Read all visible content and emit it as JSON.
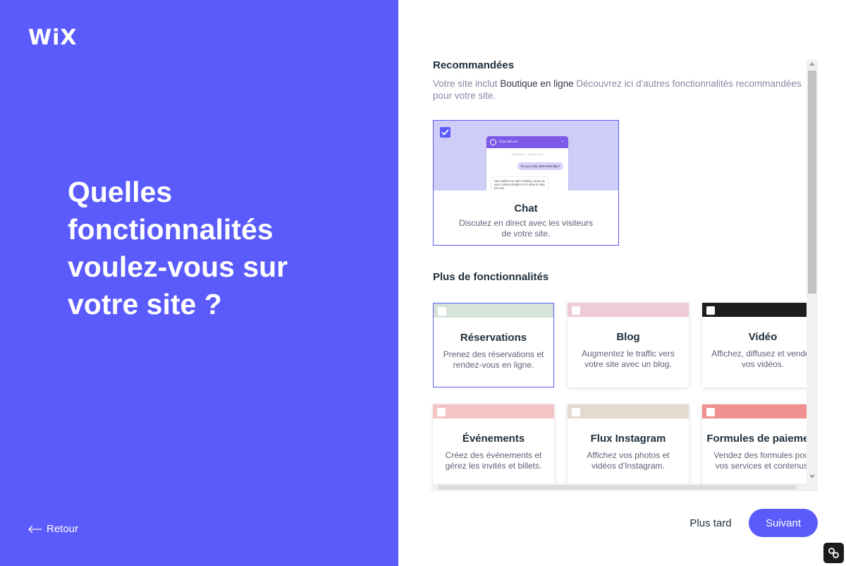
{
  "brand": {
    "logo_text": "WiX",
    "accent_color": "#5a5bfa"
  },
  "left_panel": {
    "headline": "Quelles fonctionnalités voulez-vous sur votre site ?",
    "back_label": "Retour"
  },
  "recommended": {
    "title": "Recommandées",
    "desc_prefix": "Votre site inclut ",
    "desc_highlight": "Boutique en ligne",
    "desc_suffix": " Découvrez ici d'autres fonctionnalités recommandées pour votre site.",
    "chat_card": {
      "title": "Chat",
      "description": "Discutez en direct avec les visiteurs de votre site.",
      "checked": true,
      "preview": {
        "header": "Chat with us!",
        "date": "10:00 AM — Jan 11, 2019",
        "visitor_msg": "Do you ship internationally?",
        "reply_msg": "Hey! Before we start chatting, leave us your contact details so it's easy to help you out."
      }
    }
  },
  "more": {
    "title": "Plus de fonctionnalités",
    "cards": [
      {
        "title": "Réservations",
        "description": "Prenez des réservations et rendez-vous en ligne.",
        "color": "#d6e3d8",
        "selected": true
      },
      {
        "title": "Blog",
        "description": "Augmentez le traffic vers votre site avec un blog.",
        "color": "#efcad9"
      },
      {
        "title": "Vidéo",
        "description": "Affichez, diffusez et vendez vos vidéos.",
        "color": "#1d1d1d"
      },
      {
        "title": "Événements",
        "description": "Créez des événements et gérez les invités et billets.",
        "color": "#f3c4c3"
      },
      {
        "title": "Flux Instagram",
        "description": "Affichez vos photos et vidéos d'Instagram.",
        "color": "#e4dbd0"
      },
      {
        "title": "Formules de paiement",
        "description": "Vendez des formules pour vos services et contenus.",
        "color": "#ef9090"
      }
    ]
  },
  "footer": {
    "later_label": "Plus tard",
    "next_label": "Suivant"
  }
}
